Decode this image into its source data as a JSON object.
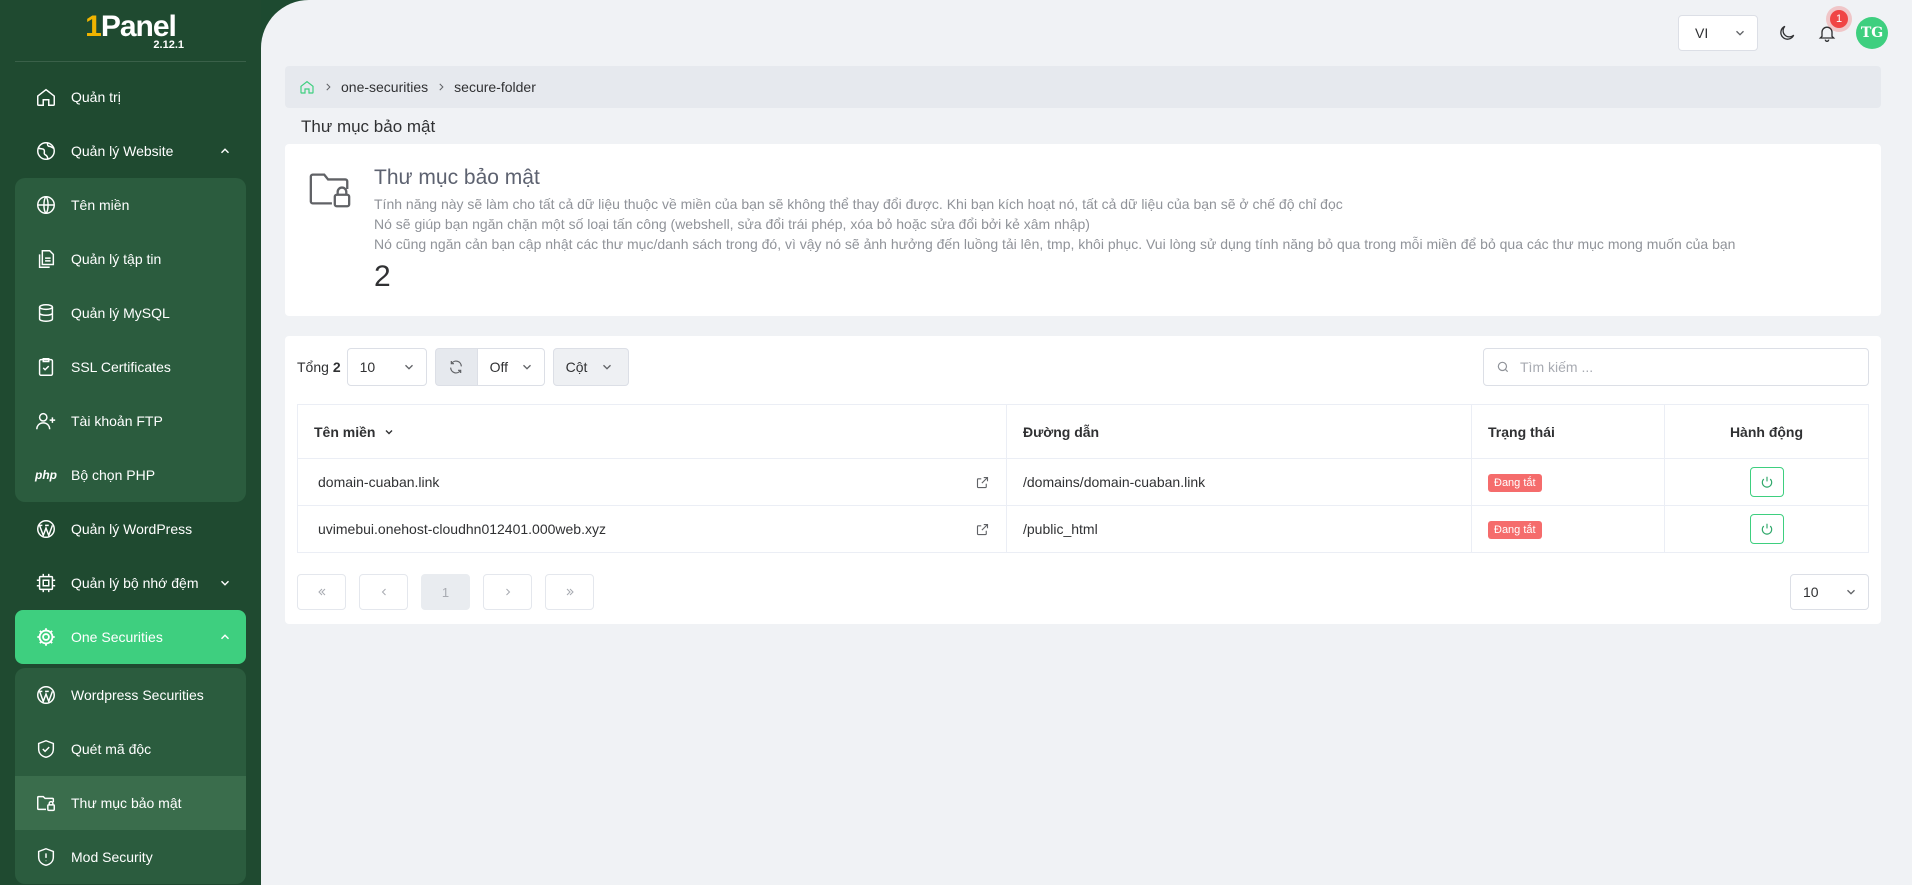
{
  "app": {
    "logo_one": "1",
    "logo_name": "Panel",
    "version": "2.12.1"
  },
  "sidebar": {
    "items": [
      {
        "label": "Quản trị",
        "icon": "home-icon"
      },
      {
        "label": "Quản lý Website",
        "icon": "globe-icon"
      },
      {
        "label": "Tên miền",
        "icon": "globe-icon"
      },
      {
        "label": "Quản lý tập tin",
        "icon": "files-icon"
      },
      {
        "label": "Quản lý MySQL",
        "icon": "database-icon"
      },
      {
        "label": "SSL Certificates",
        "icon": "certificate-icon"
      },
      {
        "label": "Tài khoản FTP",
        "icon": "user-plus-icon"
      },
      {
        "label": "Bộ chọn PHP",
        "icon": "php-icon",
        "glyph": "php"
      },
      {
        "label": "Quản lý WordPress",
        "icon": "wordpress-icon"
      },
      {
        "label": "Quản lý bộ nhớ đệm",
        "icon": "cache-icon"
      },
      {
        "label": "One Securities",
        "icon": "gear-icon"
      },
      {
        "label": "Wordpress Securities",
        "icon": "wordpress-icon"
      },
      {
        "label": "Quét mã độc",
        "icon": "shield-check-icon"
      },
      {
        "label": "Thư mục bảo mật",
        "icon": "folder-lock-icon"
      },
      {
        "label": "Mod Security",
        "icon": "shield-alert-icon"
      }
    ]
  },
  "topbar": {
    "language": "VI",
    "notification_count": "1",
    "avatar_initials": "TG"
  },
  "breadcrumb": [
    "one-securities",
    "secure-folder"
  ],
  "page": {
    "title": "Thư mục bảo mật"
  },
  "info": {
    "title": "Thư mục bảo mật",
    "line1": "Tính năng này sẽ làm cho tất cả dữ liệu thuộc về miền của bạn sẽ không thể thay đổi được. Khi bạn kích hoạt nó, tất cả dữ liệu của bạn sẽ ở chế độ chỉ đọc",
    "line2": "Nó sẽ giúp bạn ngăn chặn một số loại tấn công (webshell, sửa đổi trái phép, xóa bỏ hoặc sửa đổi bởi kẻ xâm nhập)",
    "line3": "Nó cũng ngăn cản bạn cập nhật các thư mục/danh sách trong đó, vì vậy nó sẽ ảnh hưởng đến luồng tải lên, tmp, khôi phục. Vui lòng sử dụng tính năng bỏ qua trong mỗi miền để bỏ qua các thư mục mong muốn của bạn",
    "count": "2"
  },
  "toolbar": {
    "total_label": "Tổng",
    "total_value": "2",
    "page_size": "10",
    "refresh_value": "Off",
    "columns_label": "Cột",
    "search_placeholder": "Tìm kiếm ..."
  },
  "table": {
    "headers": [
      "Tên miền",
      "Đường dẫn",
      "Trạng thái",
      "Hành động"
    ],
    "rows": [
      {
        "domain": "domain-cuaban.link",
        "path": "/domains/domain-cuaban.link",
        "status": "Đang tắt"
      },
      {
        "domain": "uvimebui.onehost-cloudhn012401.000web.xyz",
        "path": "/public_html",
        "status": "Đang tắt"
      }
    ]
  },
  "pagination": {
    "current_page": "1",
    "page_size": "10"
  },
  "colors": {
    "sidebar_bg": "#1f4a30",
    "accent": "#3ecf7f",
    "danger": "#f56c6c"
  }
}
